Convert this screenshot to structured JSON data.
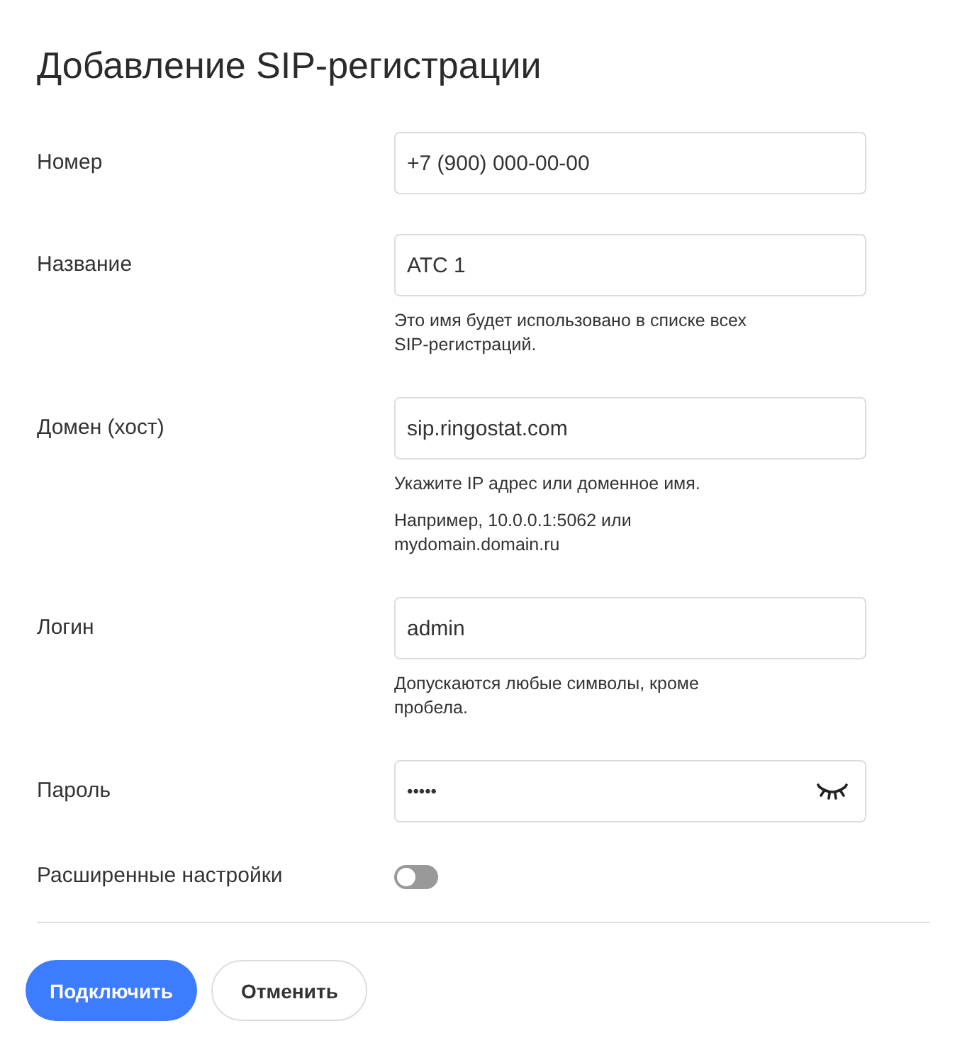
{
  "title": "Добавление SIP-регистрации",
  "fields": [
    {
      "label": "Номер",
      "kind": "text",
      "value": "+7 (900) 000-00-00"
    },
    {
      "label": "Название",
      "kind": "text",
      "value": "АТС 1",
      "hints": [
        "Это имя будет использовано в списке всех SIP-регистраций."
      ]
    },
    {
      "label": "Домен (хост)",
      "kind": "text",
      "value": "sip.ringostat.com",
      "hints": [
        "Укажите IP адрес или доменное имя.",
        "Например, 10.0.0.1:5062 или mydomain.domain.ru"
      ]
    },
    {
      "label": "Логин",
      "kind": "text",
      "value": "admin",
      "hints": [
        "Допускаются любые символы, кроме пробела."
      ]
    },
    {
      "label": "Пароль",
      "kind": "password",
      "value": "•••••"
    }
  ],
  "advanced": {
    "label": "Расширенные настройки",
    "on": false
  },
  "buttons": [
    {
      "label": "Подключить",
      "kind": "primary"
    },
    {
      "label": "Отменить",
      "kind": "secondary"
    }
  ]
}
